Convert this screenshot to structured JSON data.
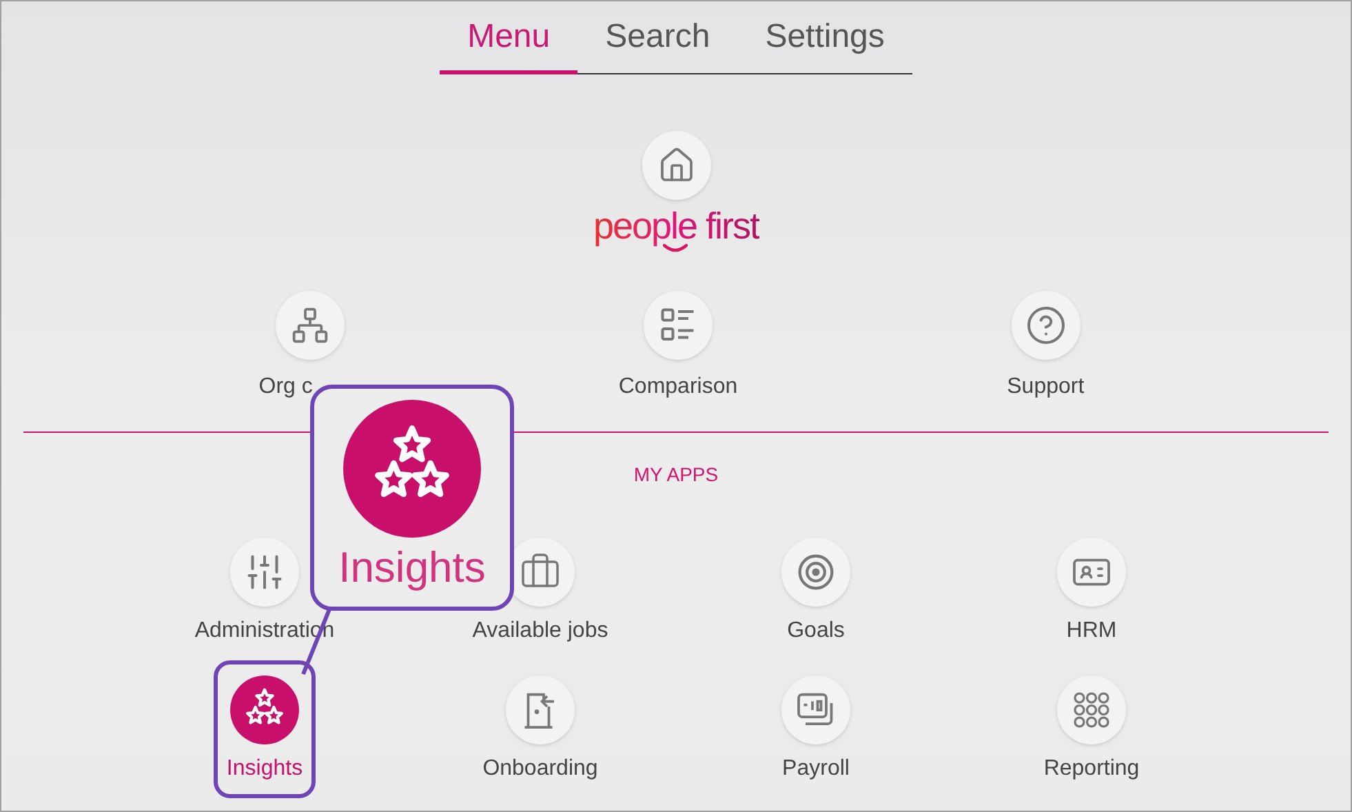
{
  "tabs": [
    {
      "label": "Menu",
      "selected": true
    },
    {
      "label": "Search",
      "selected": false
    },
    {
      "label": "Settings",
      "selected": false
    }
  ],
  "logo": {
    "text": "people first"
  },
  "quick_links": [
    {
      "label": "Org c"
    },
    {
      "label": "Comparison"
    },
    {
      "label": "Support"
    }
  ],
  "section_title": "MY APPS",
  "apps": [
    {
      "label": "Administration",
      "selected": false
    },
    {
      "label": "Available jobs",
      "selected": false
    },
    {
      "label": "Goals",
      "selected": false
    },
    {
      "label": "HRM",
      "selected": false
    },
    {
      "label": "Insights",
      "selected": true
    },
    {
      "label": "Onboarding",
      "selected": false
    },
    {
      "label": "Payroll",
      "selected": false
    },
    {
      "label": "Reporting",
      "selected": false
    }
  ],
  "callout": {
    "label": "Insights"
  }
}
